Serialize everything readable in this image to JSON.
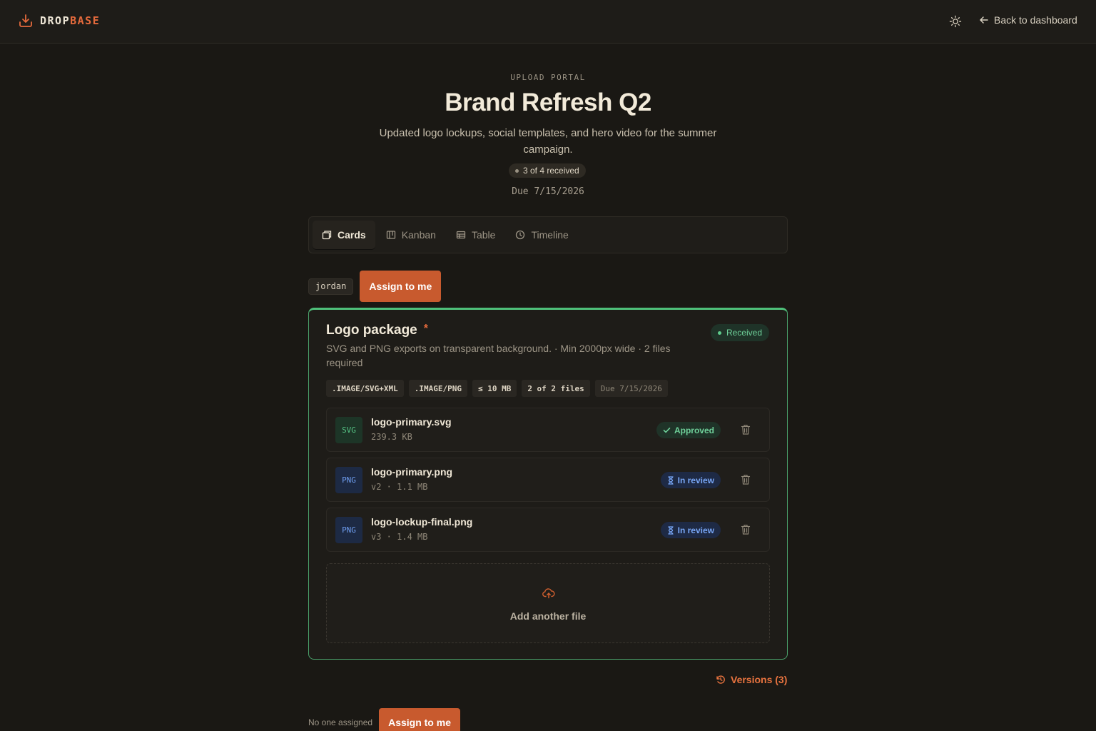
{
  "header": {
    "brand_part1": "DROP",
    "brand_part2": "BASE",
    "logo_icon": "download-tray-icon",
    "theme_icon": "sun-icon",
    "back_label": "Back to dashboard"
  },
  "hero": {
    "eyebrow": "UPLOAD PORTAL",
    "title": "Brand Refresh Q2",
    "subtitle": "Updated logo lockups, social templates, and hero video for the summer campaign.",
    "progress": "3 of 4 received",
    "due": "Due 7/15/2026"
  },
  "tabs": [
    {
      "label": "Cards",
      "icon": "cards-icon",
      "active": true
    },
    {
      "label": "Kanban",
      "icon": "kanban-icon",
      "active": false
    },
    {
      "label": "Table",
      "icon": "table-icon",
      "active": false
    },
    {
      "label": "Timeline",
      "icon": "clock-icon",
      "active": false
    }
  ],
  "request1": {
    "assignee": "jordan",
    "assign_label": "Assign to me",
    "title": "Logo package",
    "required_mark": "*",
    "status": "Received",
    "description": "SVG and PNG exports on transparent background. · Min 2000px wide · 2 files required",
    "tags": [
      ".IMAGE/SVG+XML",
      ".IMAGE/PNG",
      "≤ 10 MB",
      "2 of 2 files",
      "Due 7/15/2026"
    ],
    "files": [
      {
        "type": "SVG",
        "name": "logo-primary.svg",
        "meta": "239.3 KB",
        "status": "Approved"
      },
      {
        "type": "PNG",
        "name": "logo-primary.png",
        "meta": "v2 · 1.1 MB",
        "status": "In review"
      },
      {
        "type": "PNG",
        "name": "logo-lockup-final.png",
        "meta": "v3 · 1.4 MB",
        "status": "In review"
      }
    ],
    "add_file_label": "Add another file",
    "versions_label": "Versions (3)"
  },
  "request2": {
    "assignee": "No one assigned",
    "assign_label": "Assign to me"
  },
  "colors": {
    "accent": "#c85a2e",
    "received_border": "#4fc07a",
    "approved": "#6fd19a",
    "in_review": "#78a6f5"
  }
}
